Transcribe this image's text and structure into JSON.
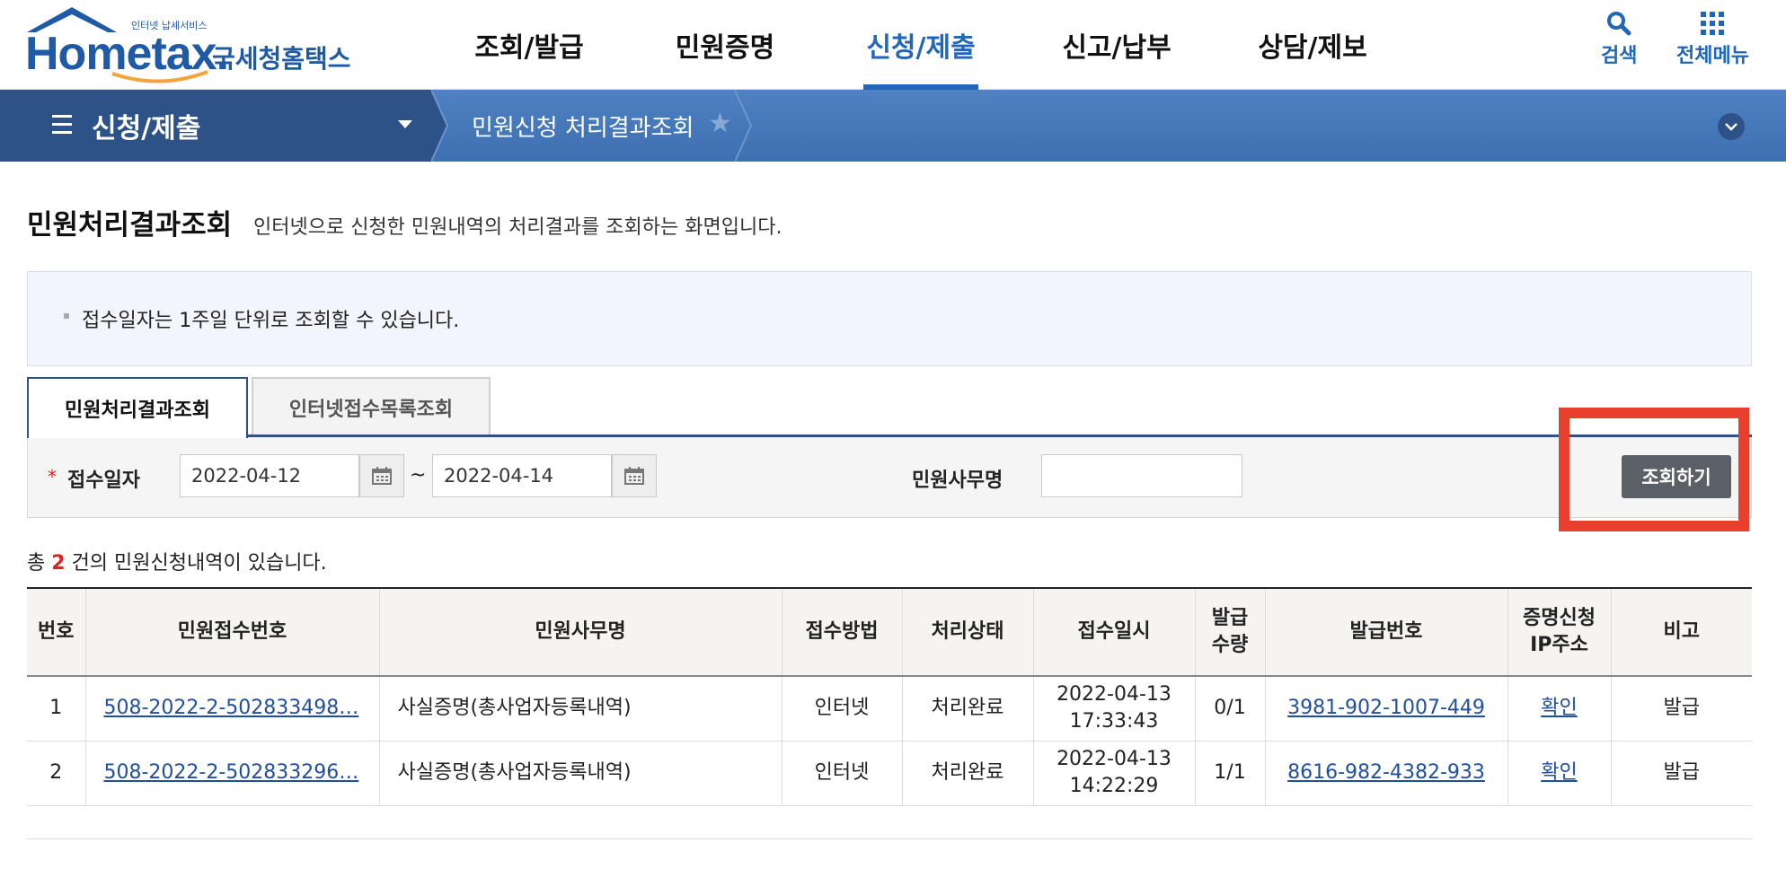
{
  "header": {
    "logo_text": "Hometax.",
    "logo_small": "인터넷 납세서비스",
    "logo_kr": "국세청홈택스",
    "nav": [
      "조회/발급",
      "민원증명",
      "신청/제출",
      "신고/납부",
      "상담/제보"
    ],
    "active_nav": "신청/제출",
    "search_label": "검색",
    "menu_label": "전체메뉴"
  },
  "locbar": {
    "section": "신청/제출",
    "crumb": "민원신청 처리결과조회"
  },
  "page": {
    "title": "민원처리결과조회",
    "desc": "인터넷으로 신청한 민원내역의 처리결과를 조회하는 화면입니다."
  },
  "info": {
    "text": "접수일자는 1주일 단위로 조회할 수 있습니다."
  },
  "tabs": [
    "민원처리결과조회",
    "인터넷접수목록조회"
  ],
  "search": {
    "date_label": "접수일자",
    "date_from": "2022-04-12",
    "tilde": "~",
    "date_to": "2022-04-14",
    "name_label": "민원사무명",
    "name_value": "",
    "button": "조회하기"
  },
  "count": {
    "prefix": "총",
    "number": "2",
    "suffix": "건의 민원신청내역이 있습니다."
  },
  "table": {
    "headers": [
      "번호",
      "민원접수번호",
      "민원사무명",
      "접수방법",
      "처리상태",
      "접수일시",
      "발급\n수량",
      "발급번호",
      "증명신청\nIP주소",
      "비고"
    ],
    "rows": [
      {
        "no": "1",
        "receipt": "508-2022-2-502833498…",
        "name": "사실증명(총사업자등록내역)",
        "method": "인터넷",
        "status": "처리완료",
        "date": "2022-04-13",
        "time": "17:33:43",
        "qty": "0/1",
        "issue_no": "3981-902-1007-449",
        "ip": "확인",
        "note": "발급"
      },
      {
        "no": "2",
        "receipt": "508-2022-2-502833296…",
        "name": "사실증명(총사업자등록내역)",
        "method": "인터넷",
        "status": "처리완료",
        "date": "2022-04-13",
        "time": "14:22:29",
        "qty": "1/1",
        "issue_no": "8616-982-4382-933",
        "ip": "확인",
        "note": "발급"
      }
    ]
  },
  "colors": {
    "brand": "#1f5aa6",
    "active_nav": "#2166b8",
    "locbar": "#3d6fb1",
    "locbar_dark": "#2d5287",
    "highlight": "#e8402c",
    "count_number": "#dd2222"
  }
}
